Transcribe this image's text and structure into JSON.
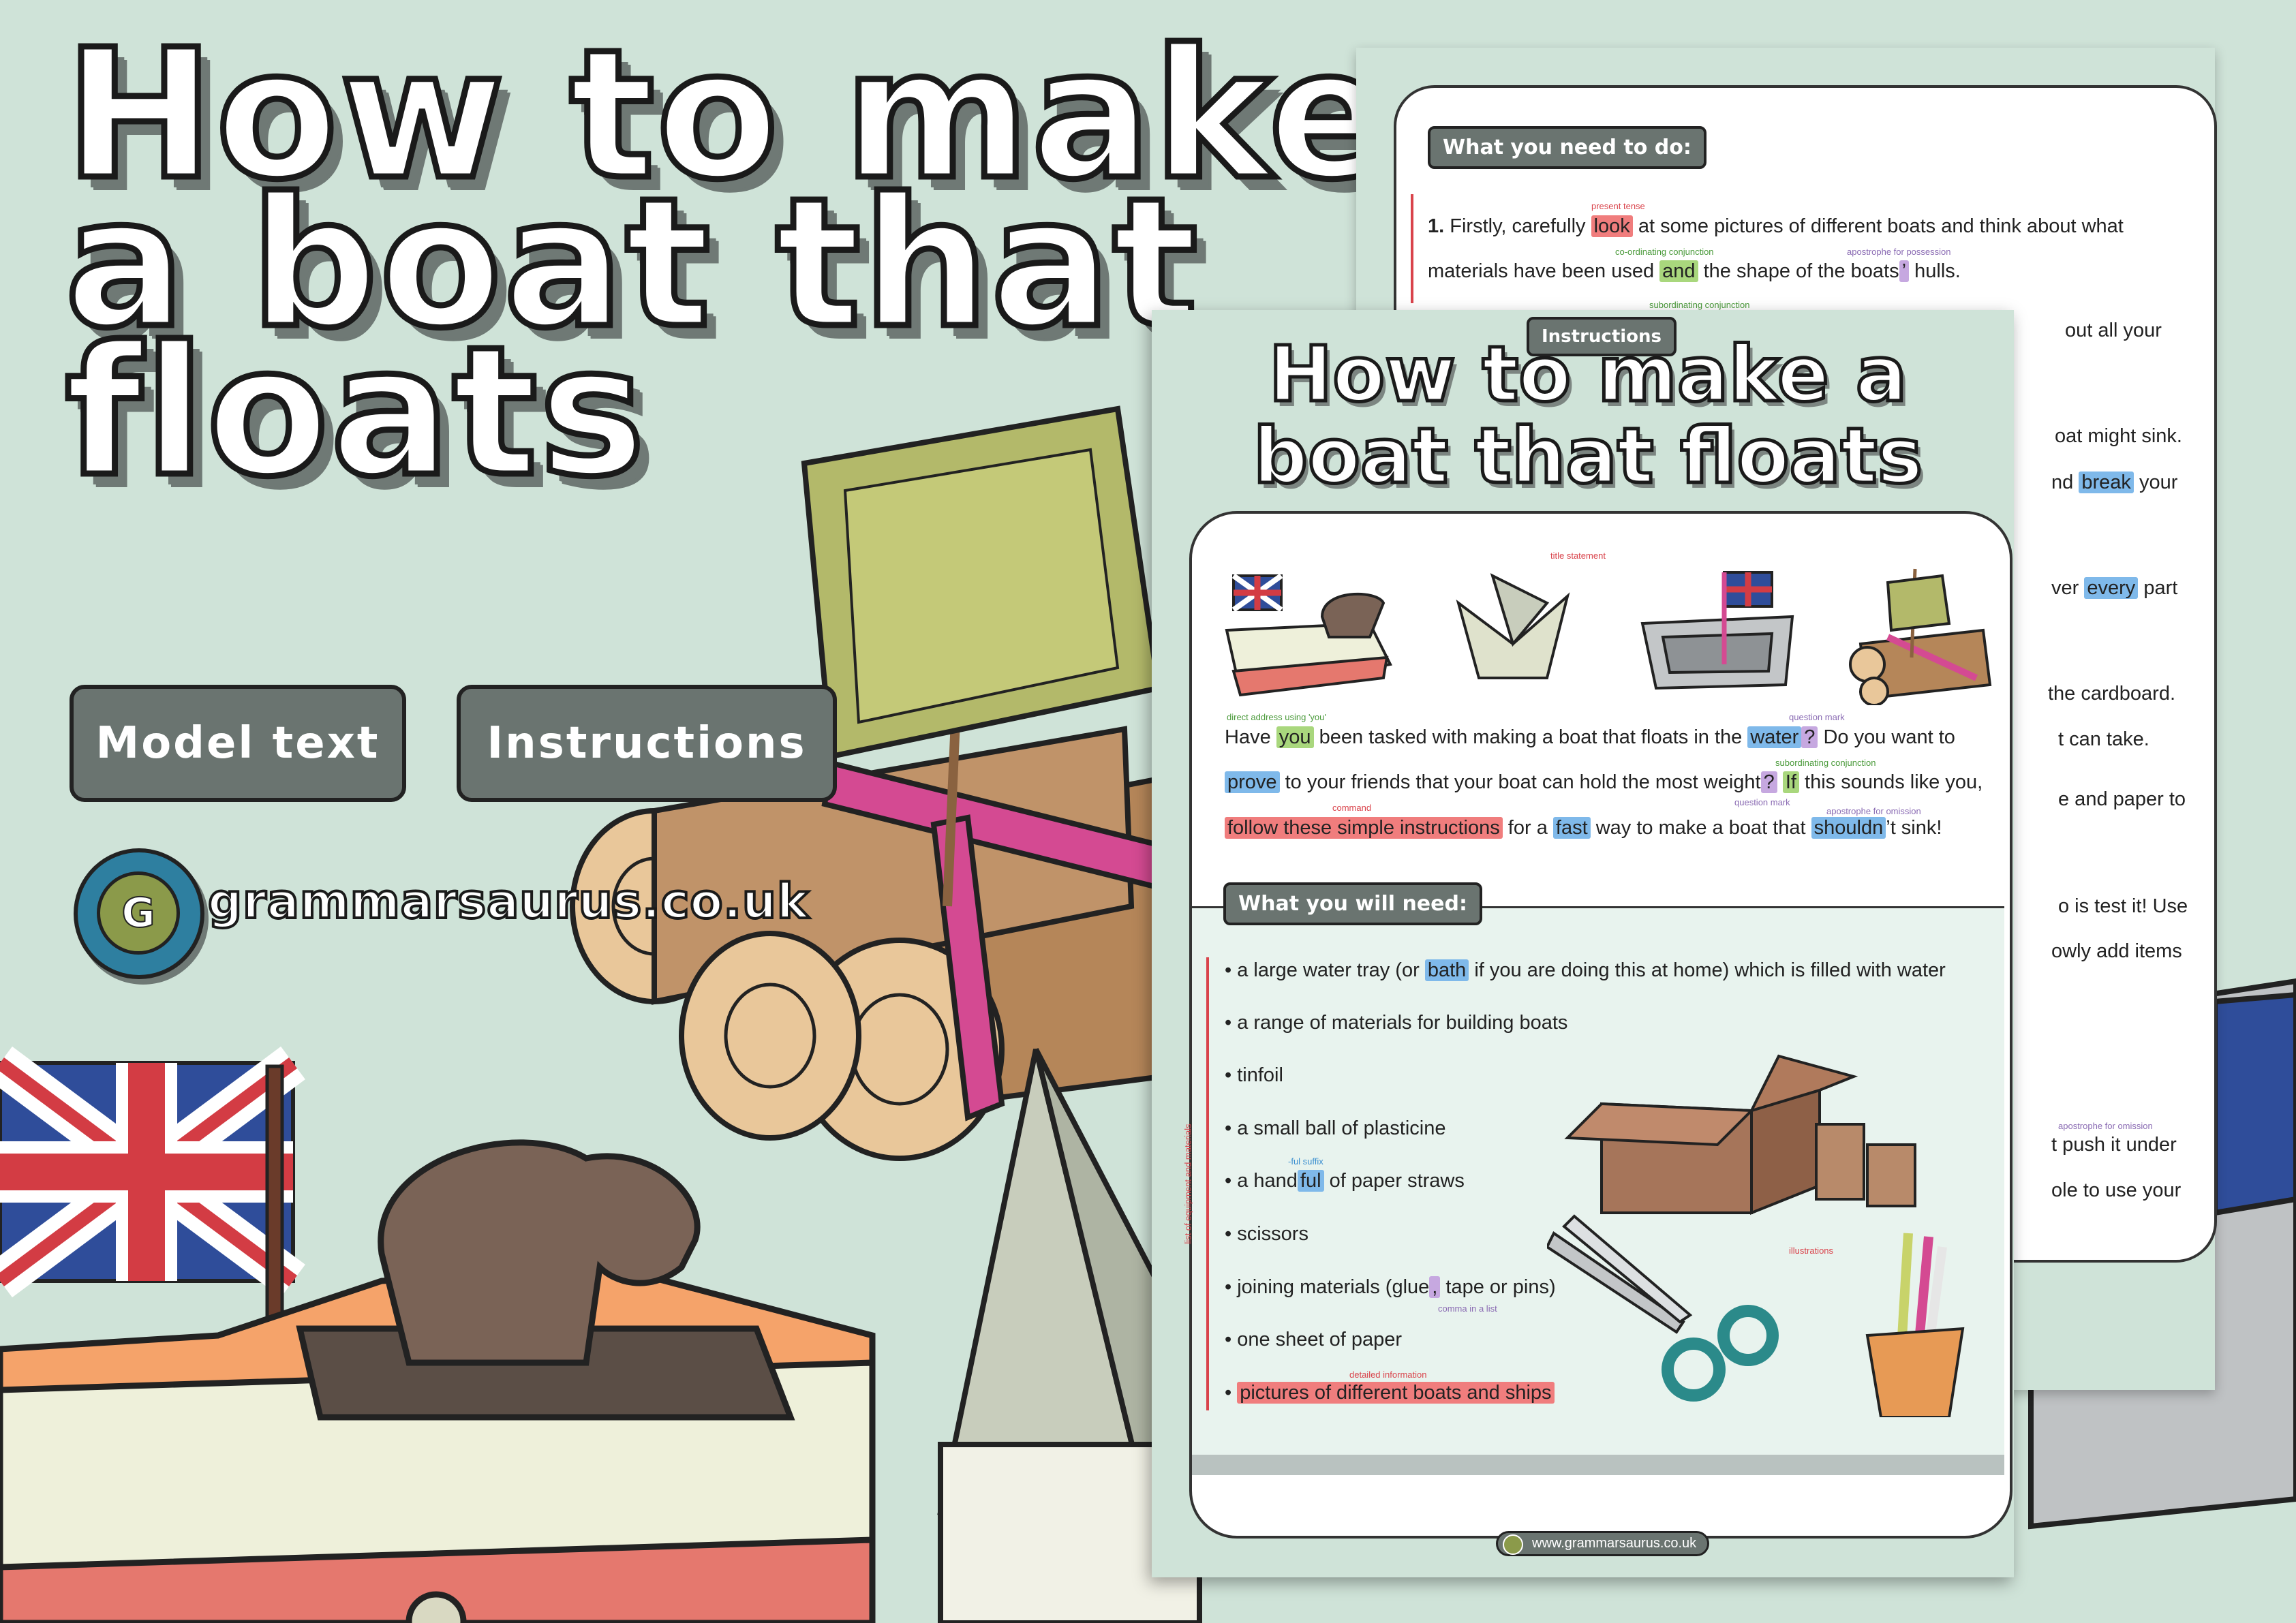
{
  "title_lines": [
    "How to make",
    "a boat that",
    "floats"
  ],
  "tags": {
    "model_text": "Model text",
    "instructions": "Instructions"
  },
  "logo": {
    "text": "grammarsaurus.co.uk",
    "glyph": "G"
  },
  "back_page": {
    "section": "What you need to do:",
    "step_number": "1.",
    "line1": [
      "Firstly, carefully ",
      "look",
      " at some pictures of different boats and think about what"
    ],
    "line2": [
      "materials have been used ",
      "and",
      " the shape of the boats",
      "’",
      " hulls."
    ],
    "notes": {
      "present_tense": "present tense",
      "coordinating": "co-ordinating conjunction",
      "apostrophe_possession": "apostrophe for possession",
      "subordinating": "subordinating conjunction",
      "apostrophe_omission": "apostrophe for omission"
    },
    "fragments": [
      "out  all  your",
      "oat might sink.",
      "nd",
      "break",
      "your",
      "ver",
      "every",
      "part",
      "the cardboard.",
      "t can take.",
      "e and paper to",
      "o is test it! Use",
      "owly add items",
      "t push it under",
      "ole to use your"
    ]
  },
  "front_page": {
    "tag": "Instructions",
    "title_lines": [
      "How to make a",
      "boat that floats"
    ],
    "notes": {
      "title_statement": "title statement",
      "direct_address": "direct address using 'you'",
      "question_mark": "question mark",
      "subordinating": "subordinating conjunction",
      "command": "command",
      "question_mark2": "question mark",
      "apostrophe_omission": "apostrophe for omission",
      "ful_suffix": "-ful suffix",
      "comma_list": "comma in a list",
      "detailed": "detailed information",
      "illustrations": "illustrations",
      "list_materials": "list of equipment and materials"
    },
    "intro": {
      "l1": [
        "Have ",
        "you",
        " been tasked with making a boat that floats in the ",
        "water",
        "?",
        " Do you want to"
      ],
      "l2": [
        "prove",
        " to your friends that your boat can hold the most weight",
        "?",
        " ",
        "If",
        " this sounds like you,"
      ],
      "l3": [
        "follow these simple instructions",
        " for a ",
        "fast",
        " way to make a boat that ",
        "shouldn",
        "’t sink!"
      ]
    },
    "need_title": "What you will need:",
    "items": [
      [
        "• a large water tray (or ",
        "bath",
        " if you are doing this at home) which is filled with water"
      ],
      [
        "• a range of materials for building boats"
      ],
      [
        "• tinfoil"
      ],
      [
        "• a small ball of plasticine"
      ],
      [
        "• a hand",
        "ful",
        " of paper straws"
      ],
      [
        "• scissors"
      ],
      [
        "• joining materials (glue",
        ",",
        " tape or pins)"
      ],
      [
        "• one sheet of paper"
      ],
      [
        "• ",
        "pictures of different boats and ships"
      ]
    ],
    "footer": "www.grammarsaurus.co.uk"
  },
  "colors": {
    "background": "#cfe3d8",
    "pill": "#6a7470",
    "highlight_red": "#f07d7d",
    "highlight_green": "#a9d77d",
    "highlight_blue": "#7fb9ea",
    "highlight_purple": "#c6a8e0",
    "annotation_red": "#d9434b"
  },
  "icons": [
    "union-jack-flag-icon",
    "boat-icon",
    "paper-boat-icon",
    "tinfoil-tray-boat-icon",
    "raft-icon",
    "cardboard-box-icon",
    "scissors-icon",
    "straws-pot-icon",
    "logo-icon"
  ]
}
